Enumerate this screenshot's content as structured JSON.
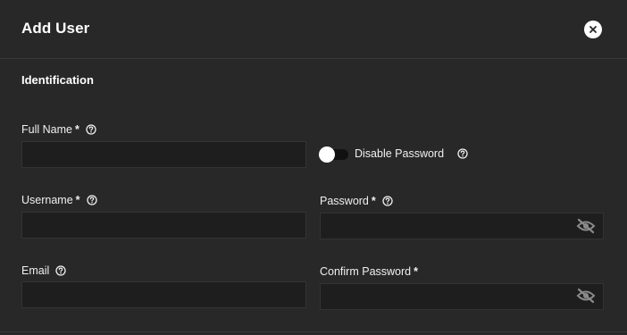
{
  "dialog": {
    "title": "Add User",
    "close_icon": "close-icon"
  },
  "section": {
    "title": "Identification"
  },
  "fields": {
    "full_name": {
      "label": "Full Name",
      "required": "*",
      "value": "",
      "placeholder": ""
    },
    "username": {
      "label": "Username",
      "required": "*",
      "value": "",
      "placeholder": ""
    },
    "email": {
      "label": "Email",
      "value": "",
      "placeholder": ""
    },
    "password": {
      "label": "Password",
      "required": "*",
      "value": "",
      "placeholder": "",
      "icon": "eye-off-icon"
    },
    "confirm_password": {
      "label": "Confirm Password",
      "required": "*",
      "value": "",
      "placeholder": "",
      "icon": "eye-off-icon"
    }
  },
  "disable_password": {
    "label": "Disable Password",
    "checked": false
  },
  "icons": {
    "help": "help-circle-icon"
  },
  "colors": {
    "background": "#282828",
    "input_background": "#1e1e1e",
    "text": "#f0f0f0",
    "icon_grey": "#8a8a8a"
  }
}
